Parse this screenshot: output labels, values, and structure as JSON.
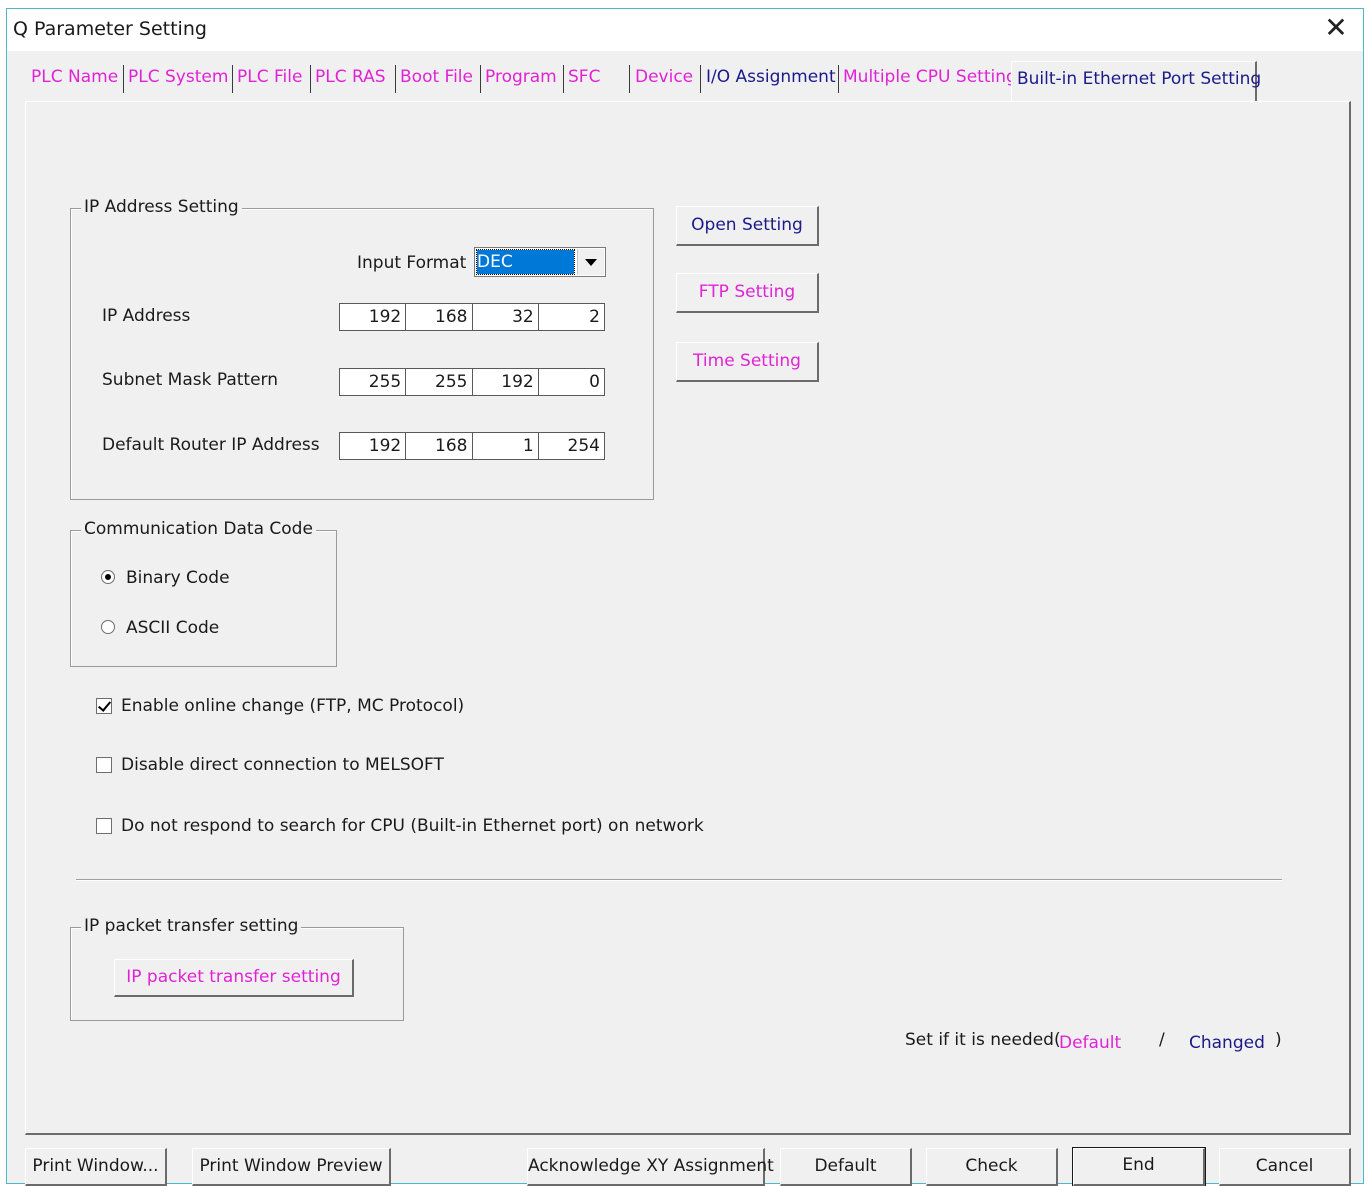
{
  "window": {
    "title": "Q Parameter Setting",
    "close_glyph": "✕"
  },
  "tabs": [
    {
      "label": "PLC Name",
      "color": "#e023d6"
    },
    {
      "label": "PLC System",
      "color": "#e023d6"
    },
    {
      "label": "PLC File",
      "color": "#e023d6"
    },
    {
      "label": "PLC RAS",
      "color": "#e023d6"
    },
    {
      "label": "Boot File",
      "color": "#e023d6"
    },
    {
      "label": "Program",
      "color": "#e023d6"
    },
    {
      "label": "SFC",
      "color": "#e023d6"
    },
    {
      "label": "Device",
      "color": "#e023d6"
    },
    {
      "label": "I/O Assignment",
      "color": "#1a1a8a"
    },
    {
      "label": "Multiple CPU Setting",
      "color": "#e023d6"
    },
    {
      "label": "Built-in Ethernet Port Setting",
      "color": "#1a1a8a",
      "active": true
    }
  ],
  "ip_setting": {
    "legend": "IP Address Setting",
    "input_format_label": "Input Format",
    "input_format_value": "DEC",
    "rows": [
      {
        "label": "IP Address",
        "octets": [
          "192",
          "168",
          "32",
          "2"
        ]
      },
      {
        "label": "Subnet Mask Pattern",
        "octets": [
          "255",
          "255",
          "192",
          "0"
        ]
      },
      {
        "label": "Default Router IP Address",
        "octets": [
          "192",
          "168",
          "1",
          "254"
        ]
      }
    ]
  },
  "side_buttons": {
    "open_setting": "Open Setting",
    "ftp_setting": "FTP Setting",
    "time_setting": "Time Setting"
  },
  "comm_code": {
    "legend": "Communication Data Code",
    "binary": "Binary Code",
    "ascii": "ASCII Code",
    "selected": "binary"
  },
  "checkboxes": [
    {
      "label": "Enable online change (FTP, MC Protocol)",
      "checked": true
    },
    {
      "label": "Disable direct connection to MELSOFT",
      "checked": false
    },
    {
      "label": "Do not respond to search for CPU (Built-in Ethernet port) on network",
      "checked": false
    }
  ],
  "ip_packet": {
    "legend": "IP packet transfer setting",
    "button": "IP packet transfer setting"
  },
  "legend_note": {
    "prefix": "Set if it is needed(",
    "default": "Default",
    "slash": "/",
    "changed": "Changed",
    "suffix": ")"
  },
  "bottom_buttons": {
    "print_window": "Print Window...",
    "print_preview": "Print Window Preview",
    "acknowledge": "Acknowledge XY Assignment",
    "default": "Default",
    "check": "Check",
    "end": "End",
    "cancel": "Cancel"
  },
  "colors": {
    "pink": "#e023d6",
    "navy": "#1a1a8a",
    "selection": "#0078d7",
    "window_border": "#4fb8c8"
  }
}
